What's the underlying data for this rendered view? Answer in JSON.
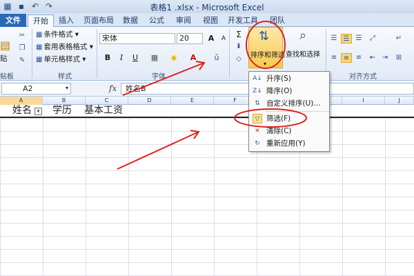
{
  "window": {
    "title": "表格1 .xlsx - Microsoft Excel"
  },
  "tabs": [
    "文件",
    "开始",
    "插入",
    "页面布局",
    "数据",
    "公式",
    "审阅",
    "视图",
    "开发工具",
    "团队"
  ],
  "ribbon": {
    "clipboard": {
      "paste": "贴",
      "label": "贴板"
    },
    "styles": {
      "conditional": "条件格式",
      "table": "套用表格格式",
      "cell": "单元格样式",
      "label": "样式"
    },
    "font": {
      "name": "宋体",
      "size": "20",
      "bold": "B",
      "italic": "I",
      "underline": "U",
      "grow": "A",
      "shrink": "A",
      "label": "字体"
    },
    "editing": {
      "sort_filter": "排序和筛选",
      "find_select": "查找和选择"
    },
    "alignment": {
      "label": "对齐方式"
    }
  },
  "formula_bar": {
    "name_box": "A2",
    "fx": "fx",
    "content": "姓名B"
  },
  "columns": [
    "A",
    "B",
    "C",
    "D",
    "E",
    "F",
    "G",
    "H",
    "I",
    "J"
  ],
  "row2_cells": [
    "姓名",
    "学历",
    "基本工资"
  ],
  "dropdown": {
    "items": [
      {
        "label": "升序(S)",
        "icon": "sort-asc-icon",
        "glyph": "A↓"
      },
      {
        "label": "降序(O)",
        "icon": "sort-desc-icon",
        "glyph": "Z↓"
      },
      {
        "label": "自定义排序(U)...",
        "icon": "custom-sort-icon",
        "glyph": "⇅"
      },
      {
        "label": "筛选(F)",
        "icon": "filter-icon",
        "glyph": "▽"
      },
      {
        "label": "清除(C)",
        "icon": "clear-filter-icon",
        "glyph": "✕"
      },
      {
        "label": "重新应用(Y)",
        "icon": "reapply-icon",
        "glyph": "↻"
      }
    ]
  },
  "colors": {
    "file_tab": "#2a68b8",
    "annotation": "#e0201b",
    "highlight": "#f9d99b"
  }
}
